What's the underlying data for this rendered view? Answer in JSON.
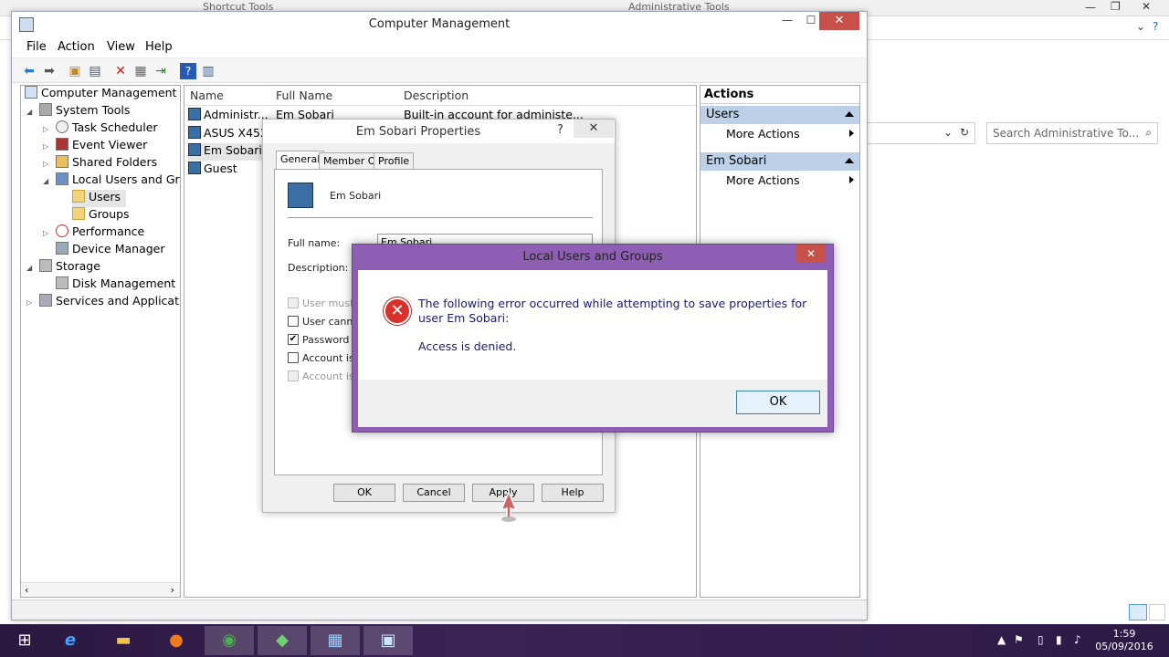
{
  "background_window": {
    "ribbon_tab": "Shortcut Tools",
    "title": "Administrative Tools",
    "search_placeholder": "Search Administrative To..."
  },
  "mmc": {
    "title": "Computer Management",
    "menu": [
      "File",
      "Action",
      "View",
      "Help"
    ],
    "tree": [
      {
        "label": "Computer Management (Lo",
        "indent": 0
      },
      {
        "label": "System Tools",
        "indent": 1
      },
      {
        "label": "Task Scheduler",
        "indent": 2
      },
      {
        "label": "Event Viewer",
        "indent": 2
      },
      {
        "label": "Shared Folders",
        "indent": 2
      },
      {
        "label": "Local Users and Grou",
        "indent": 2
      },
      {
        "label": "Users",
        "indent": 3
      },
      {
        "label": "Groups",
        "indent": 3
      },
      {
        "label": "Performance",
        "indent": 2
      },
      {
        "label": "Device Manager",
        "indent": 2
      },
      {
        "label": "Storage",
        "indent": 1
      },
      {
        "label": "Disk Management",
        "indent": 2
      },
      {
        "label": "Services and Application",
        "indent": 1
      }
    ],
    "list_columns": [
      "Name",
      "Full Name",
      "Description"
    ],
    "list_rows": [
      {
        "name": "Administr...",
        "full_name": "Em Sobari",
        "description": "Built-in account for administe..."
      },
      {
        "name": "ASUS X452",
        "full_name": "",
        "description": ""
      },
      {
        "name": "Em Sobari",
        "full_name": "",
        "description": ""
      },
      {
        "name": "Guest",
        "full_name": "",
        "description": ""
      }
    ],
    "actions": {
      "header": "Actions",
      "sections": [
        {
          "title": "Users",
          "item": "More Actions"
        },
        {
          "title": "Em Sobari",
          "item": "More Actions"
        }
      ]
    }
  },
  "props": {
    "title": "Em Sobari Properties",
    "tabs": [
      "General",
      "Member Of",
      "Profile"
    ],
    "user_name": "Em Sobari",
    "full_name_label": "Full name:",
    "full_name_value": "Em Sobari",
    "description_label": "Description:",
    "checkboxes": [
      {
        "label": "User must ch",
        "checked": false,
        "disabled": true
      },
      {
        "label": "User cannot",
        "checked": false,
        "disabled": false
      },
      {
        "label": "Password ne",
        "checked": true,
        "disabled": false
      },
      {
        "label": "Account is d",
        "checked": false,
        "disabled": false
      },
      {
        "label": "Account is lo",
        "checked": false,
        "disabled": true
      }
    ],
    "buttons": {
      "ok": "OK",
      "cancel": "Cancel",
      "apply": "Apply",
      "help": "Help"
    }
  },
  "error_dialog": {
    "title": "Local Users and Groups",
    "message": "The following error occurred while attempting to save properties for user Em Sobari:",
    "detail": "Access is denied.",
    "ok": "OK"
  },
  "taskbar": {
    "time": "1:59",
    "date": "05/09/2016"
  }
}
